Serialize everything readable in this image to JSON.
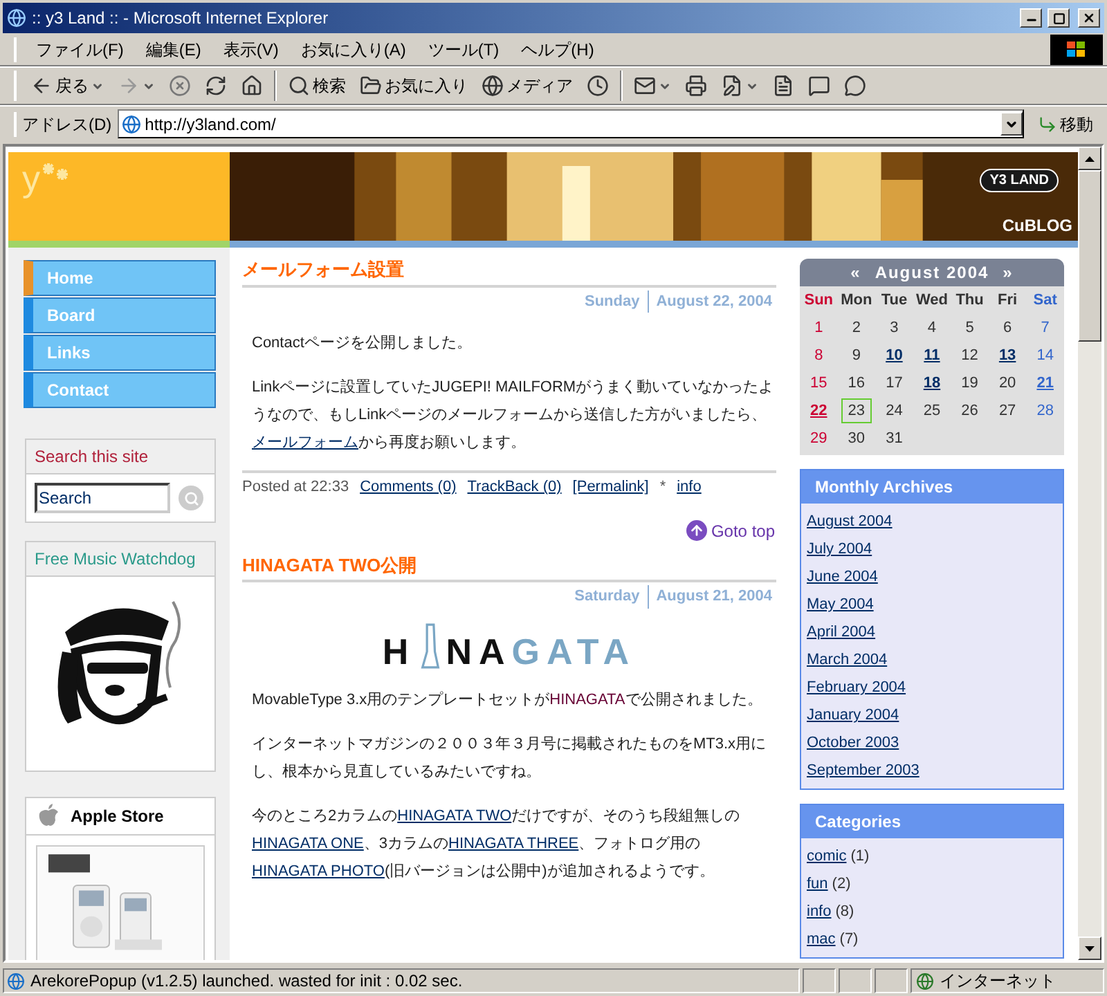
{
  "window": {
    "title": ":: y3 Land :: - Microsoft Internet Explorer"
  },
  "menu": [
    "ファイル(F)",
    "編集(E)",
    "表示(V)",
    "お気に入り(A)",
    "ツール(T)",
    "ヘルプ(H)"
  ],
  "toolbar": [
    {
      "kind": "back",
      "label": "戻る",
      "dropdown": true
    },
    {
      "kind": "forward",
      "dropdown": true
    },
    {
      "kind": "stop",
      "dropdown": false
    },
    {
      "kind": "refresh",
      "dropdown": false
    },
    {
      "kind": "home",
      "dropdown": false
    },
    {
      "kind": "separator"
    },
    {
      "kind": "search",
      "label": "検索",
      "dropdown": false
    },
    {
      "kind": "favorites",
      "label": "お気に入り",
      "dropdown": false
    },
    {
      "kind": "media",
      "label": "メディア",
      "dropdown": false
    },
    {
      "kind": "history",
      "dropdown": false
    },
    {
      "kind": "separator"
    },
    {
      "kind": "mail",
      "dropdown": true
    },
    {
      "kind": "print",
      "dropdown": false
    },
    {
      "kind": "edit",
      "dropdown": true
    },
    {
      "kind": "document",
      "dropdown": false
    },
    {
      "kind": "messenger",
      "dropdown": false
    },
    {
      "kind": "chat",
      "dropdown": false
    }
  ],
  "address": {
    "label": "アドレス(D)",
    "value": "http://y3land.com/",
    "go": "移動"
  },
  "header": {
    "logo": "y",
    "badge": "Y3 LAND",
    "caption": "CuBLOG"
  },
  "nav": [
    {
      "label": "Home",
      "selected": true
    },
    {
      "label": "Board",
      "selected": false
    },
    {
      "label": "Links",
      "selected": false
    },
    {
      "label": "Contact",
      "selected": false
    }
  ],
  "search": {
    "title": "Search this site",
    "value": "Search"
  },
  "watchdog": {
    "title": "Free Music Watchdog"
  },
  "apple": {
    "title": "Apple Store"
  },
  "posts": [
    {
      "title": "メールフォーム設置",
      "day": "Sunday",
      "date": "August 22, 2004",
      "paragraphs": [
        [
          {
            "text": "Contactページを公開しました。",
            "kind": "plain"
          }
        ],
        [
          {
            "text": "Linkページに設置していたJUGEPI!  MAILFORMがうまく動いていなかったようなので、もしLinkページのメールフォームから送信した方がいましたら、",
            "kind": "plain"
          },
          {
            "text": "メールフォーム",
            "kind": "link"
          },
          {
            "text": "から再度お願いします。",
            "kind": "plain"
          }
        ]
      ],
      "footer": [
        {
          "text": "Posted at 22:33",
          "kind": "plain"
        },
        {
          "text": "Comments (0)",
          "kind": "link"
        },
        {
          "text": "TrackBack (0)",
          "kind": "link"
        },
        {
          "text": "[Permalink]",
          "kind": "link"
        },
        {
          "text": "*",
          "kind": "plain"
        },
        {
          "text": "info",
          "kind": "link"
        }
      ],
      "goto": "Goto top"
    },
    {
      "title": "HINAGATA TWO公開",
      "day": "Saturday",
      "date": "August 21, 2004",
      "logo": [
        "H",
        "NA",
        "GATA"
      ],
      "paragraphs": [
        [
          {
            "text": "MovableType 3.x用のテンプレートセットが",
            "kind": "plain"
          },
          {
            "text": "HINAGATA",
            "kind": "accent"
          },
          {
            "text": "で公開されました。",
            "kind": "plain"
          }
        ],
        [
          {
            "text": "インターネットマガジンの２００３年３月号に掲載されたものをMT3.x用にし、根本から見直しているみたいですね。",
            "kind": "plain"
          }
        ],
        [
          {
            "text": "今のところ2カラムの",
            "kind": "plain"
          },
          {
            "text": "HINAGATA TWO",
            "kind": "link"
          },
          {
            "text": "だけですが、そのうち段組無しの",
            "kind": "plain"
          },
          {
            "text": "HINAGATA ONE",
            "kind": "link"
          },
          {
            "text": "、3カラムの",
            "kind": "plain"
          },
          {
            "text": "HINAGATA THREE",
            "kind": "link"
          },
          {
            "text": "、フォトログ用の",
            "kind": "plain"
          },
          {
            "text": "HINAGATA PHOTO",
            "kind": "link"
          },
          {
            "text": "(旧バージョンは公開中)が追加されるようです。",
            "kind": "plain"
          }
        ]
      ]
    }
  ],
  "calendar": {
    "prev": "«",
    "title": "August 2004",
    "next": "»",
    "weekdays": [
      {
        "label": "Sun",
        "kind": "sun"
      },
      {
        "label": "Mon",
        "kind": "wd"
      },
      {
        "label": "Tue",
        "kind": "wd"
      },
      {
        "label": "Wed",
        "kind": "wd"
      },
      {
        "label": "Thu",
        "kind": "wd"
      },
      {
        "label": "Fri",
        "kind": "wd"
      },
      {
        "label": "Sat",
        "kind": "sat"
      }
    ],
    "days": [
      {
        "day": "1",
        "kind": "sun",
        "linked": false,
        "today": false
      },
      {
        "day": "2",
        "kind": "wd",
        "linked": false,
        "today": false
      },
      {
        "day": "3",
        "kind": "wd",
        "linked": false,
        "today": false
      },
      {
        "day": "4",
        "kind": "wd",
        "linked": false,
        "today": false
      },
      {
        "day": "5",
        "kind": "wd",
        "linked": false,
        "today": false
      },
      {
        "day": "6",
        "kind": "wd",
        "linked": false,
        "today": false
      },
      {
        "day": "7",
        "kind": "sat",
        "linked": false,
        "today": false
      },
      {
        "day": "8",
        "kind": "sun",
        "linked": false,
        "today": false
      },
      {
        "day": "9",
        "kind": "wd",
        "linked": false,
        "today": false
      },
      {
        "day": "10",
        "kind": "wd",
        "linked": true,
        "today": false
      },
      {
        "day": "11",
        "kind": "wd",
        "linked": true,
        "today": false
      },
      {
        "day": "12",
        "kind": "wd",
        "linked": false,
        "today": false
      },
      {
        "day": "13",
        "kind": "wd",
        "linked": true,
        "today": false
      },
      {
        "day": "14",
        "kind": "sat",
        "linked": false,
        "today": false
      },
      {
        "day": "15",
        "kind": "sun",
        "linked": false,
        "today": false
      },
      {
        "day": "16",
        "kind": "wd",
        "linked": false,
        "today": false
      },
      {
        "day": "17",
        "kind": "wd",
        "linked": false,
        "today": false
      },
      {
        "day": "18",
        "kind": "wd",
        "linked": true,
        "today": false
      },
      {
        "day": "19",
        "kind": "wd",
        "linked": false,
        "today": false
      },
      {
        "day": "20",
        "kind": "wd",
        "linked": false,
        "today": false
      },
      {
        "day": "21",
        "kind": "sat",
        "linked": true,
        "today": false
      },
      {
        "day": "22",
        "kind": "sun",
        "linked": true,
        "today": false
      },
      {
        "day": "23",
        "kind": "wd",
        "linked": false,
        "today": true
      },
      {
        "day": "24",
        "kind": "wd",
        "linked": false,
        "today": false
      },
      {
        "day": "25",
        "kind": "wd",
        "linked": false,
        "today": false
      },
      {
        "day": "26",
        "kind": "wd",
        "linked": false,
        "today": false
      },
      {
        "day": "27",
        "kind": "wd",
        "linked": false,
        "today": false
      },
      {
        "day": "28",
        "kind": "sat",
        "linked": false,
        "today": false
      },
      {
        "day": "29",
        "kind": "sun",
        "linked": false,
        "today": false
      },
      {
        "day": "30",
        "kind": "wd",
        "linked": false,
        "today": false
      },
      {
        "day": "31",
        "kind": "wd",
        "linked": false,
        "today": false
      }
    ]
  },
  "archives": {
    "title": "Monthly Archives",
    "items": [
      "August 2004",
      "July 2004",
      "June 2004",
      "May 2004",
      "April 2004",
      "March 2004",
      "February 2004",
      "January 2004",
      "October 2003",
      "September 2003"
    ]
  },
  "categories": {
    "title": "Categories",
    "items": [
      {
        "name": "comic",
        "count": "(1)"
      },
      {
        "name": "fun",
        "count": "(2)"
      },
      {
        "name": "info",
        "count": "(8)"
      },
      {
        "name": "mac",
        "count": "(7)"
      }
    ]
  },
  "status": {
    "text": "ArekorePopup (v1.2.5) launched. wasted for init : 0.02 sec.",
    "zone": "インターネット"
  }
}
